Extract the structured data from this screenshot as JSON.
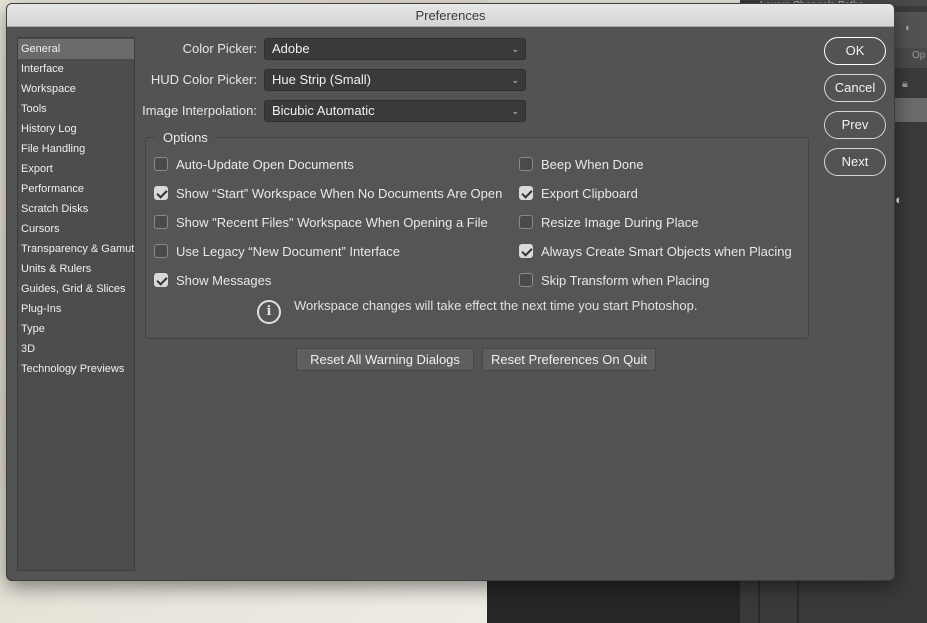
{
  "window": {
    "title": "Preferences"
  },
  "background": {
    "panel_tabs": "Layers  Channels  Paths",
    "panel_field_fragment": "Op"
  },
  "sidebar": {
    "items": [
      {
        "label": "General",
        "selected": true
      },
      {
        "label": "Interface"
      },
      {
        "label": "Workspace"
      },
      {
        "label": "Tools"
      },
      {
        "label": "History Log"
      },
      {
        "label": "File Handling"
      },
      {
        "label": "Export"
      },
      {
        "label": "Performance"
      },
      {
        "label": "Scratch Disks"
      },
      {
        "label": "Cursors"
      },
      {
        "label": "Transparency & Gamut"
      },
      {
        "label": "Units & Rulers"
      },
      {
        "label": "Guides, Grid & Slices"
      },
      {
        "label": "Plug-Ins"
      },
      {
        "label": "Type"
      },
      {
        "label": "3D"
      },
      {
        "label": "Technology Previews"
      }
    ]
  },
  "fields": {
    "color_picker": {
      "label": "Color Picker:",
      "value": "Adobe"
    },
    "hud_color_picker": {
      "label": "HUD Color Picker:",
      "value": "Hue Strip (Small)"
    },
    "image_interpolation": {
      "label": "Image Interpolation:",
      "value": "Bicubic Automatic"
    }
  },
  "options": {
    "legend": "Options",
    "left": [
      {
        "label": "Auto-Update Open Documents",
        "checked": false
      },
      {
        "label": "Show “Start” Workspace When No Documents Are Open",
        "checked": true
      },
      {
        "label": "Show \"Recent Files\" Workspace When Opening a File",
        "checked": false
      },
      {
        "label": "Use Legacy “New Document” Interface",
        "checked": false
      },
      {
        "label": "Show Messages",
        "checked": true
      }
    ],
    "right": [
      {
        "label": "Beep When Done",
        "checked": false
      },
      {
        "label": "Export Clipboard",
        "checked": true
      },
      {
        "label": "Resize Image During Place",
        "checked": false
      },
      {
        "label": "Always Create Smart Objects when Placing",
        "checked": true
      },
      {
        "label": "Skip Transform when Placing",
        "checked": false
      }
    ],
    "info_icon": "i",
    "info_text": "Workspace changes will take effect the next time you start Photoshop."
  },
  "reset_buttons": {
    "warnings": "Reset All Warning Dialogs",
    "on_quit": "Reset Preferences On Quit"
  },
  "actions": {
    "ok": "OK",
    "cancel": "Cancel",
    "prev": "Prev",
    "next": "Next"
  }
}
